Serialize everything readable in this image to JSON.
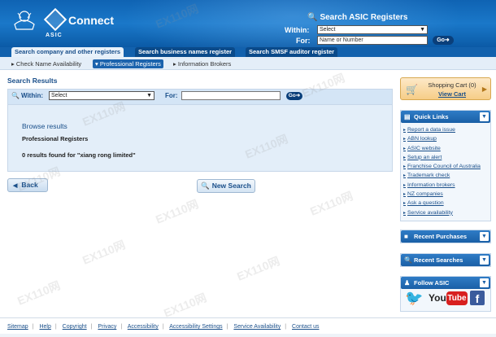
{
  "header": {
    "brand": "Connect",
    "org": "ASIC",
    "search_title": "Search ASIC Registers",
    "within_label": "Within:",
    "for_label": "For:",
    "within_value": "Select",
    "for_placeholder": "Name or Number",
    "go_label": "Go"
  },
  "tabs": [
    {
      "label": "Search company and other registers"
    },
    {
      "label": "Search business names register"
    },
    {
      "label": "Search SMSF auditor register"
    }
  ],
  "subnav": [
    {
      "label": "Check Name Availability"
    },
    {
      "label": "Professional Registers"
    },
    {
      "label": "Information Brokers"
    }
  ],
  "main": {
    "title": "Search Results",
    "within_label": "Within:",
    "within_value": "Select",
    "for_label": "For:",
    "go_label": "Go",
    "browse_heading": "Browse results",
    "register_name": "Professional Registers",
    "result_text": "0 results found for \"xiang rong limited\"",
    "back_label": "Back",
    "new_search_label": "New Search"
  },
  "sidebar": {
    "cart_title": "Shopping Cart (0)",
    "cart_link": "View Cart",
    "quick_links_title": "Quick Links",
    "quick_links": [
      "Report a data issue",
      "ABN lookup",
      "ASIC website",
      "Setup an alert",
      "Franchise Council of Australia",
      "Trademark check",
      "Information brokers",
      "NZ companies",
      "Ask a question",
      "Service availability"
    ],
    "recent_purchases": "Recent Purchases",
    "recent_searches": "Recent Searches",
    "follow": "Follow ASIC",
    "youtube_you": "You",
    "youtube_tube": "Tube",
    "facebook": "f"
  },
  "footer": [
    "Sitemap",
    "Help",
    "Copyright",
    "Privacy",
    "Accessibility",
    "Accessibility Settings",
    "Service Availability",
    "Contact us"
  ],
  "watermark": "EX110网",
  "colors": {
    "header_blue": "#1a78c9",
    "link_blue": "#1a4f8a",
    "panel_bg": "#e3eef9",
    "cart_orange": "#f6cd87"
  }
}
